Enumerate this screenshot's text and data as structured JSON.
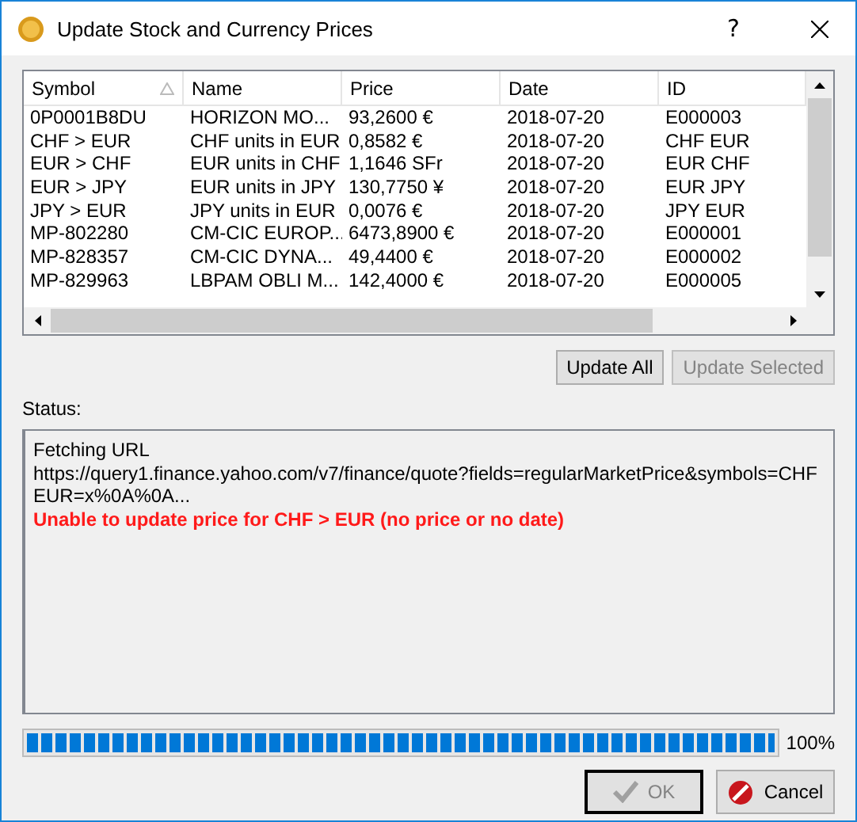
{
  "window": {
    "title": "Update Stock and Currency Prices",
    "help": "?"
  },
  "table": {
    "columns": [
      {
        "label": "Symbol",
        "sorted": true
      },
      {
        "label": "Name",
        "sorted": false
      },
      {
        "label": "Price",
        "sorted": false
      },
      {
        "label": "Date",
        "sorted": false
      },
      {
        "label": "ID",
        "sorted": false
      }
    ],
    "rows": [
      [
        "0P0001B8DU",
        "HORIZON MO...",
        "93,2600 €",
        "2018-07-20",
        "E000003"
      ],
      [
        "CHF > EUR",
        "CHF units in EUR",
        "0,8582 €",
        "2018-07-20",
        "CHF EUR"
      ],
      [
        "EUR > CHF",
        "EUR units in CHF",
        "1,1646 SFr",
        "2018-07-20",
        "EUR CHF"
      ],
      [
        "EUR > JPY",
        "EUR units in JPY",
        "130,7750 ¥",
        "2018-07-20",
        "EUR JPY"
      ],
      [
        "JPY > EUR",
        "JPY units in EUR",
        "0,0076 €",
        "2018-07-20",
        "JPY EUR"
      ],
      [
        "MP-802280",
        "CM-CIC EUROP...",
        "6473,8900 €",
        "2018-07-20",
        "E000001"
      ],
      [
        "MP-828357",
        "CM-CIC DYNA...",
        "49,4400 €",
        "2018-07-20",
        "E000002"
      ],
      [
        "MP-829963",
        "LBPAM OBLI M...",
        "142,4000 €",
        "2018-07-20",
        "E000005"
      ]
    ]
  },
  "actions": [
    {
      "label": "Update All",
      "disabled": false
    },
    {
      "label": "Update Selected",
      "disabled": true
    }
  ],
  "status": {
    "label": "Status:",
    "lines": [
      {
        "kind": "info",
        "text": "Fetching URL"
      },
      {
        "kind": "info",
        "text": "https://query1.finance.yahoo.com/v7/finance/quote?fields=regularMarketPrice&symbols=CHFEUR=x%0A%0A..."
      },
      {
        "kind": "error",
        "text": "Unable to update price for CHF > EUR (no price or no date)"
      }
    ]
  },
  "progress": {
    "level": 1,
    "reading": "100%"
  },
  "buttons": [
    {
      "kind": "ok",
      "label": "OK",
      "disabled": true
    },
    {
      "kind": "cancel",
      "label": "Cancel",
      "disabled": false
    }
  ]
}
